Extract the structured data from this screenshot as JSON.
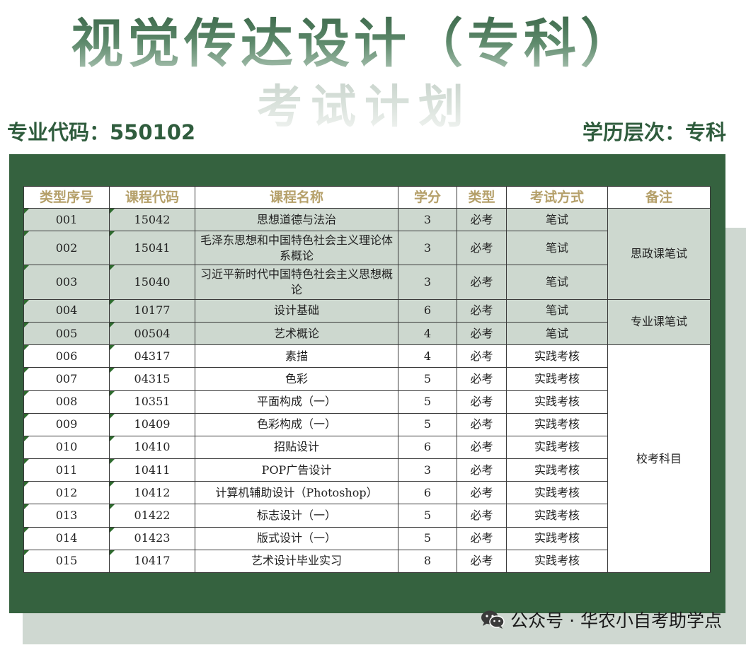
{
  "header": {
    "title": "视觉传达设计（专科）",
    "subtitle": "考试计划",
    "major_code_label": "专业代码：550102",
    "level_label": "学历层次：专科"
  },
  "table": {
    "columns": [
      "类型序号",
      "课程代码",
      "课程名称",
      "学分",
      "类型",
      "考试方式",
      "备注"
    ],
    "rows": [
      {
        "seq": "001",
        "code": "15042",
        "name": "思想道德与法治",
        "credit": "3",
        "type": "必考",
        "exam": "笔试"
      },
      {
        "seq": "002",
        "code": "15041",
        "name": "毛泽东思想和中国特色社会主义理论体系概论",
        "credit": "3",
        "type": "必考",
        "exam": "笔试"
      },
      {
        "seq": "003",
        "code": "15040",
        "name": "习近平新时代中国特色社会主义思想概论",
        "credit": "3",
        "type": "必考",
        "exam": "笔试"
      },
      {
        "seq": "004",
        "code": "10177",
        "name": "设计基础",
        "credit": "6",
        "type": "必考",
        "exam": "笔试"
      },
      {
        "seq": "005",
        "code": "00504",
        "name": "艺术概论",
        "credit": "4",
        "type": "必考",
        "exam": "笔试"
      },
      {
        "seq": "006",
        "code": "04317",
        "name": "素描",
        "credit": "4",
        "type": "必考",
        "exam": "实践考核"
      },
      {
        "seq": "007",
        "code": "04315",
        "name": "色彩",
        "credit": "5",
        "type": "必考",
        "exam": "实践考核"
      },
      {
        "seq": "008",
        "code": "10351",
        "name": "平面构成（一）",
        "credit": "5",
        "type": "必考",
        "exam": "实践考核"
      },
      {
        "seq": "009",
        "code": "10409",
        "name": "色彩构成（一）",
        "credit": "5",
        "type": "必考",
        "exam": "实践考核"
      },
      {
        "seq": "010",
        "code": "10410",
        "name": "招贴设计",
        "credit": "6",
        "type": "必考",
        "exam": "实践考核"
      },
      {
        "seq": "011",
        "code": "10411",
        "name": "POP广告设计",
        "credit": "3",
        "type": "必考",
        "exam": "实践考核"
      },
      {
        "seq": "012",
        "code": "10412",
        "name": "计算机辅助设计（Photoshop）",
        "credit": "6",
        "type": "必考",
        "exam": "实践考核"
      },
      {
        "seq": "013",
        "code": "01422",
        "name": "标志设计（一）",
        "credit": "5",
        "type": "必考",
        "exam": "实践考核"
      },
      {
        "seq": "014",
        "code": "01423",
        "name": "版式设计（一）",
        "credit": "5",
        "type": "必考",
        "exam": "实践考核"
      },
      {
        "seq": "015",
        "code": "10417",
        "name": "艺术设计毕业实习",
        "credit": "8",
        "type": "必考",
        "exam": "实践考核"
      }
    ],
    "remarks": {
      "group1": "思政课笔试",
      "group2": "专业课笔试",
      "group3": "校考科目"
    }
  },
  "footer": {
    "icon": "wechat-icon",
    "watermark": "公众号 · 华农小自考助学点"
  },
  "colors": {
    "panel_green": "#35623f",
    "row_shade": "#cdd8cf",
    "header_text": "#b5a06a",
    "title_green": "#2f5c3d"
  }
}
